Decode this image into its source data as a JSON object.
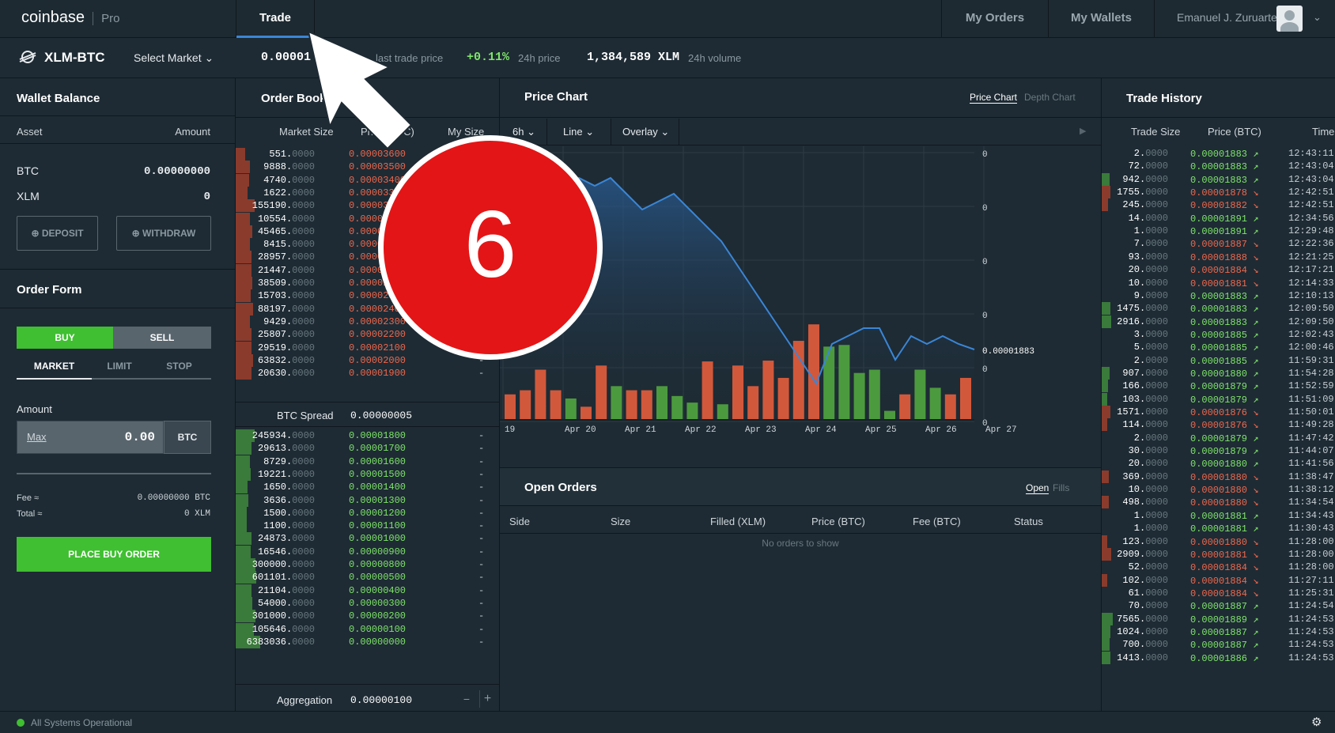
{
  "topbar": {
    "logo": "coinbase",
    "logo_suffix": "Pro",
    "tab_trade": "Trade",
    "my_orders": "My Orders",
    "my_wallets": "My Wallets",
    "user_name": "Emanuel J. Zuruarte"
  },
  "market": {
    "pair": "XLM-BTC",
    "select_market": "Select Market",
    "last_price": "0.00001",
    "last_label": "last trade price",
    "change": "+0.11%",
    "change_label": "24h price",
    "volume": "1,384,589 XLM",
    "volume_label": "24h volume"
  },
  "wallet": {
    "title": "Wallet Balance",
    "col_asset": "Asset",
    "col_amount": "Amount",
    "rows": [
      {
        "asset": "BTC",
        "amount": "0.00000000"
      },
      {
        "asset": "XLM",
        "amount": "0"
      }
    ],
    "deposit": "DEPOSIT",
    "withdraw": "WITHDRAW"
  },
  "order_form": {
    "title": "Order Form",
    "buy": "BUY",
    "sell": "SELL",
    "tabs": [
      "MARKET",
      "LIMIT",
      "STOP"
    ],
    "amount_label": "Amount",
    "max": "Max",
    "amount_value": "0.00",
    "currency": "BTC",
    "fee_label": "Fee ≈",
    "fee_value": "0.00000000 BTC",
    "total_label": "Total ≈",
    "total_value": "0 XLM",
    "place": "PLACE BUY ORDER"
  },
  "order_book": {
    "title": "Order Book",
    "col_market_size": "Market Size",
    "col_price": "Price (BTC)",
    "col_my_size": "My Size",
    "asks": [
      [
        "551.",
        "0000",
        "0.00003600"
      ],
      [
        "9888.",
        "0000",
        "0.00003500"
      ],
      [
        "4740.",
        "0000",
        "0.00003400"
      ],
      [
        "1622.",
        "0000",
        "0.00003300"
      ],
      [
        "155190.",
        "0000",
        "0.00003200"
      ],
      [
        "10554.",
        "0000",
        "0.00003100"
      ],
      [
        "45465.",
        "0000",
        "0.00003000"
      ],
      [
        "8415.",
        "0000",
        "0.00002900"
      ],
      [
        "28957.",
        "0000",
        "0.00002800"
      ],
      [
        "21447.",
        "0000",
        "0.00002700"
      ],
      [
        "38509.",
        "0000",
        "0.00002600"
      ],
      [
        "15703.",
        "0000",
        "0.00002500"
      ],
      [
        "88197.",
        "0000",
        "0.00002400"
      ],
      [
        "9429.",
        "0000",
        "0.00002300"
      ],
      [
        "25807.",
        "0000",
        "0.00002200"
      ],
      [
        "29519.",
        "0000",
        "0.00002100"
      ],
      [
        "63832.",
        "0000",
        "0.00002000"
      ],
      [
        "20630.",
        "0000",
        "0.00001900"
      ]
    ],
    "spread_label": "BTC Spread",
    "spread_value": "0.00000005",
    "bids": [
      [
        "245934.",
        "0000",
        "0.00001800"
      ],
      [
        "29613.",
        "0000",
        "0.00001700"
      ],
      [
        "8729.",
        "0000",
        "0.00001600"
      ],
      [
        "19221.",
        "0000",
        "0.00001500"
      ],
      [
        "1650.",
        "0000",
        "0.00001400"
      ],
      [
        "3636.",
        "0000",
        "0.00001300"
      ],
      [
        "1500.",
        "0000",
        "0.00001200"
      ],
      [
        "1100.",
        "0000",
        "0.00001100"
      ],
      [
        "24873.",
        "0000",
        "0.00001000"
      ],
      [
        "16546.",
        "0000",
        "0.00000900"
      ],
      [
        "300000.",
        "0000",
        "0.00000800"
      ],
      [
        "601101.",
        "0000",
        "0.00000500"
      ],
      [
        "21104.",
        "0000",
        "0.00000400"
      ],
      [
        "54000.",
        "0000",
        "0.00000300"
      ],
      [
        "301000.",
        "0000",
        "0.00000200"
      ],
      [
        "105646.",
        "0000",
        "0.00000100"
      ],
      [
        "6383036.",
        "0000",
        "0.00000000"
      ]
    ],
    "my_size_dash": "-",
    "aggregation_label": "Aggregation",
    "aggregation_value": "0.00000100",
    "minus": "−",
    "plus": "+"
  },
  "price_chart": {
    "title": "Price Chart",
    "tab_price": "Price Chart",
    "tab_depth": "Depth Chart",
    "granularity": "6h",
    "chart_type": "Line",
    "overlay": "Overlay",
    "y_ticks": [
      "0",
      "0",
      "0",
      "0",
      "0",
      "0"
    ],
    "current_price": "0.00001883",
    "x_labels": [
      "19",
      "Apr 20",
      "Apr 21",
      "Apr 22",
      "Apr 23",
      "Apr 24",
      "Apr 25",
      "Apr 26",
      "Apr 27"
    ]
  },
  "chart_data": {
    "type": "line",
    "title": "Price Chart",
    "x_labels": [
      "19",
      "Apr 20",
      "Apr 21",
      "Apr 22",
      "Apr 23",
      "Apr 24",
      "Apr 25",
      "Apr 26",
      "Apr 27"
    ],
    "price": [
      2.05e-05,
      2.06e-05,
      2.07e-05,
      2.08e-05,
      2.09e-05,
      2.1e-05,
      2.09e-05,
      2.1e-05,
      2.08e-05,
      2.06e-05,
      2.07e-05,
      2.08e-05,
      2.06e-05,
      2.04e-05,
      2.02e-05,
      1.99e-05,
      1.96e-05,
      1.93e-05,
      1.9e-05,
      1.87e-05,
      1.84e-05,
      1.89e-05,
      1.9e-05,
      1.91e-05,
      1.91e-05,
      1.87e-05,
      1.9e-05,
      1.89e-05,
      1.9e-05,
      1.89e-05,
      1.883e-05
    ],
    "volume_colors": [
      "red",
      "red",
      "red",
      "red",
      "green",
      "red",
      "red",
      "green",
      "red",
      "red",
      "green",
      "green",
      "green",
      "red",
      "green",
      "red",
      "red",
      "red",
      "red",
      "red",
      "red",
      "green",
      "green",
      "green",
      "green",
      "green",
      "red",
      "green",
      "green",
      "red",
      "red"
    ],
    "volume": [
      3,
      3.5,
      6,
      3.5,
      2.5,
      1.5,
      6.5,
      4,
      3.5,
      3.5,
      4,
      2.8,
      2,
      7,
      1.8,
      6.5,
      4,
      7.1,
      5,
      9.5,
      11.5,
      8.8,
      9,
      5.6,
      6,
      1,
      3,
      6,
      3.8,
      3,
      5
    ]
  },
  "open_orders": {
    "title": "Open Orders",
    "tab_open": "Open",
    "tab_fills": "Fills",
    "cols": [
      "Side",
      "Size",
      "Filled (XLM)",
      "Price (BTC)",
      "Fee (BTC)",
      "Status"
    ],
    "empty": "No orders to show"
  },
  "trade_history": {
    "title": "Trade History",
    "col_size": "Trade Size",
    "col_price": "Price (BTC)",
    "col_time": "Time",
    "rows": [
      [
        "2.",
        "0000",
        "0.00001883",
        "up",
        "12:43:11"
      ],
      [
        "72.",
        "0000",
        "0.00001883",
        "up",
        "12:43:04"
      ],
      [
        "942.",
        "0000",
        "0.00001883",
        "up",
        "12:43:04"
      ],
      [
        "1755.",
        "0000",
        "0.00001878",
        "down",
        "12:42:51"
      ],
      [
        "245.",
        "0000",
        "0.00001882",
        "down",
        "12:42:51"
      ],
      [
        "14.",
        "0000",
        "0.00001891",
        "up",
        "12:34:56"
      ],
      [
        "1.",
        "0000",
        "0.00001891",
        "up",
        "12:29:48"
      ],
      [
        "7.",
        "0000",
        "0.00001887",
        "down",
        "12:22:36"
      ],
      [
        "93.",
        "0000",
        "0.00001888",
        "down",
        "12:21:25"
      ],
      [
        "20.",
        "0000",
        "0.00001884",
        "down",
        "12:17:21"
      ],
      [
        "10.",
        "0000",
        "0.00001881",
        "down",
        "12:14:33"
      ],
      [
        "9.",
        "0000",
        "0.00001883",
        "up",
        "12:10:13"
      ],
      [
        "1475.",
        "0000",
        "0.00001883",
        "up",
        "12:09:50"
      ],
      [
        "2916.",
        "0000",
        "0.00001883",
        "up",
        "12:09:50"
      ],
      [
        "3.",
        "0000",
        "0.00001885",
        "up",
        "12:02:43"
      ],
      [
        "5.",
        "0000",
        "0.00001885",
        "up",
        "12:00:46"
      ],
      [
        "2.",
        "0000",
        "0.00001885",
        "up",
        "11:59:31"
      ],
      [
        "907.",
        "0000",
        "0.00001880",
        "up",
        "11:54:28"
      ],
      [
        "166.",
        "0000",
        "0.00001879",
        "up",
        "11:52:59"
      ],
      [
        "103.",
        "0000",
        "0.00001879",
        "up",
        "11:51:09"
      ],
      [
        "1571.",
        "0000",
        "0.00001876",
        "down",
        "11:50:01"
      ],
      [
        "114.",
        "0000",
        "0.00001876",
        "down",
        "11:49:28"
      ],
      [
        "2.",
        "0000",
        "0.00001879",
        "up",
        "11:47:42"
      ],
      [
        "30.",
        "0000",
        "0.00001879",
        "up",
        "11:44:07"
      ],
      [
        "20.",
        "0000",
        "0.00001880",
        "up",
        "11:41:56"
      ],
      [
        "369.",
        "0000",
        "0.00001880",
        "down",
        "11:38:47"
      ],
      [
        "10.",
        "0000",
        "0.00001880",
        "down",
        "11:38:12"
      ],
      [
        "498.",
        "0000",
        "0.00001880",
        "down",
        "11:34:54"
      ],
      [
        "1.",
        "0000",
        "0.00001881",
        "up",
        "11:34:43"
      ],
      [
        "1.",
        "0000",
        "0.00001881",
        "up",
        "11:30:43"
      ],
      [
        "123.",
        "0000",
        "0.00001880",
        "down",
        "11:28:00"
      ],
      [
        "2909.",
        "0000",
        "0.00001881",
        "down",
        "11:28:00"
      ],
      [
        "52.",
        "0000",
        "0.00001884",
        "down",
        "11:28:00"
      ],
      [
        "102.",
        "0000",
        "0.00001884",
        "down",
        "11:27:11"
      ],
      [
        "61.",
        "0000",
        "0.00001884",
        "down",
        "11:25:31"
      ],
      [
        "70.",
        "0000",
        "0.00001887",
        "up",
        "11:24:54"
      ],
      [
        "7565.",
        "0000",
        "0.00001889",
        "up",
        "11:24:53"
      ],
      [
        "1024.",
        "0000",
        "0.00001887",
        "up",
        "11:24:53"
      ],
      [
        "700.",
        "0000",
        "0.00001887",
        "up",
        "11:24:53"
      ],
      [
        "1413.",
        "0000",
        "0.00001886",
        "up",
        "11:24:53"
      ]
    ]
  },
  "status": {
    "text": "All Systems Operational"
  },
  "overlay": {
    "step_number": "6"
  },
  "colors": {
    "accent": "#3a86d7",
    "buy": "#3fbf31",
    "sell_red": "#f0684d",
    "bid_green": "#7fe56a",
    "badge": "#e41516"
  }
}
